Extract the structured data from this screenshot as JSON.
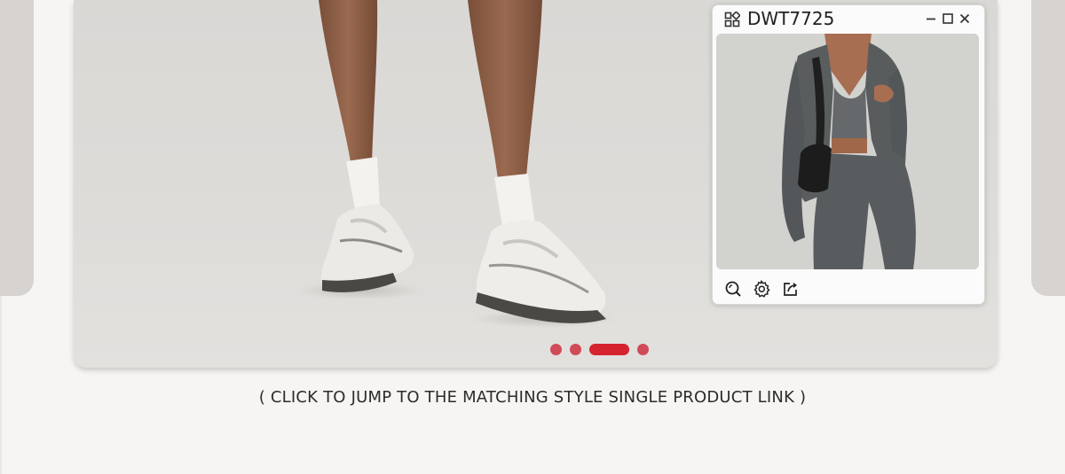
{
  "hero": {
    "slides": [
      {
        "id": "slide-1"
      },
      {
        "id": "slide-2"
      },
      {
        "id": "slide-3",
        "active": true
      },
      {
        "id": "slide-4"
      }
    ]
  },
  "caption": "( CLICK TO JUMP TO THE MATCHING STYLE SINGLE PRODUCT LINK )",
  "preview": {
    "title": "DWT7725",
    "icons": {
      "menu": "grid-icon",
      "minimize": "minimize-icon",
      "maximize": "maximize-icon",
      "close": "close-icon",
      "zoom": "zoom-icon",
      "settings": "gear-icon",
      "share": "share-icon"
    }
  },
  "colors": {
    "accent_active": "#d5232f",
    "accent_dot": "#d04a57",
    "page_bg": "#f6f5f3",
    "garment": "#5b5e5f"
  }
}
